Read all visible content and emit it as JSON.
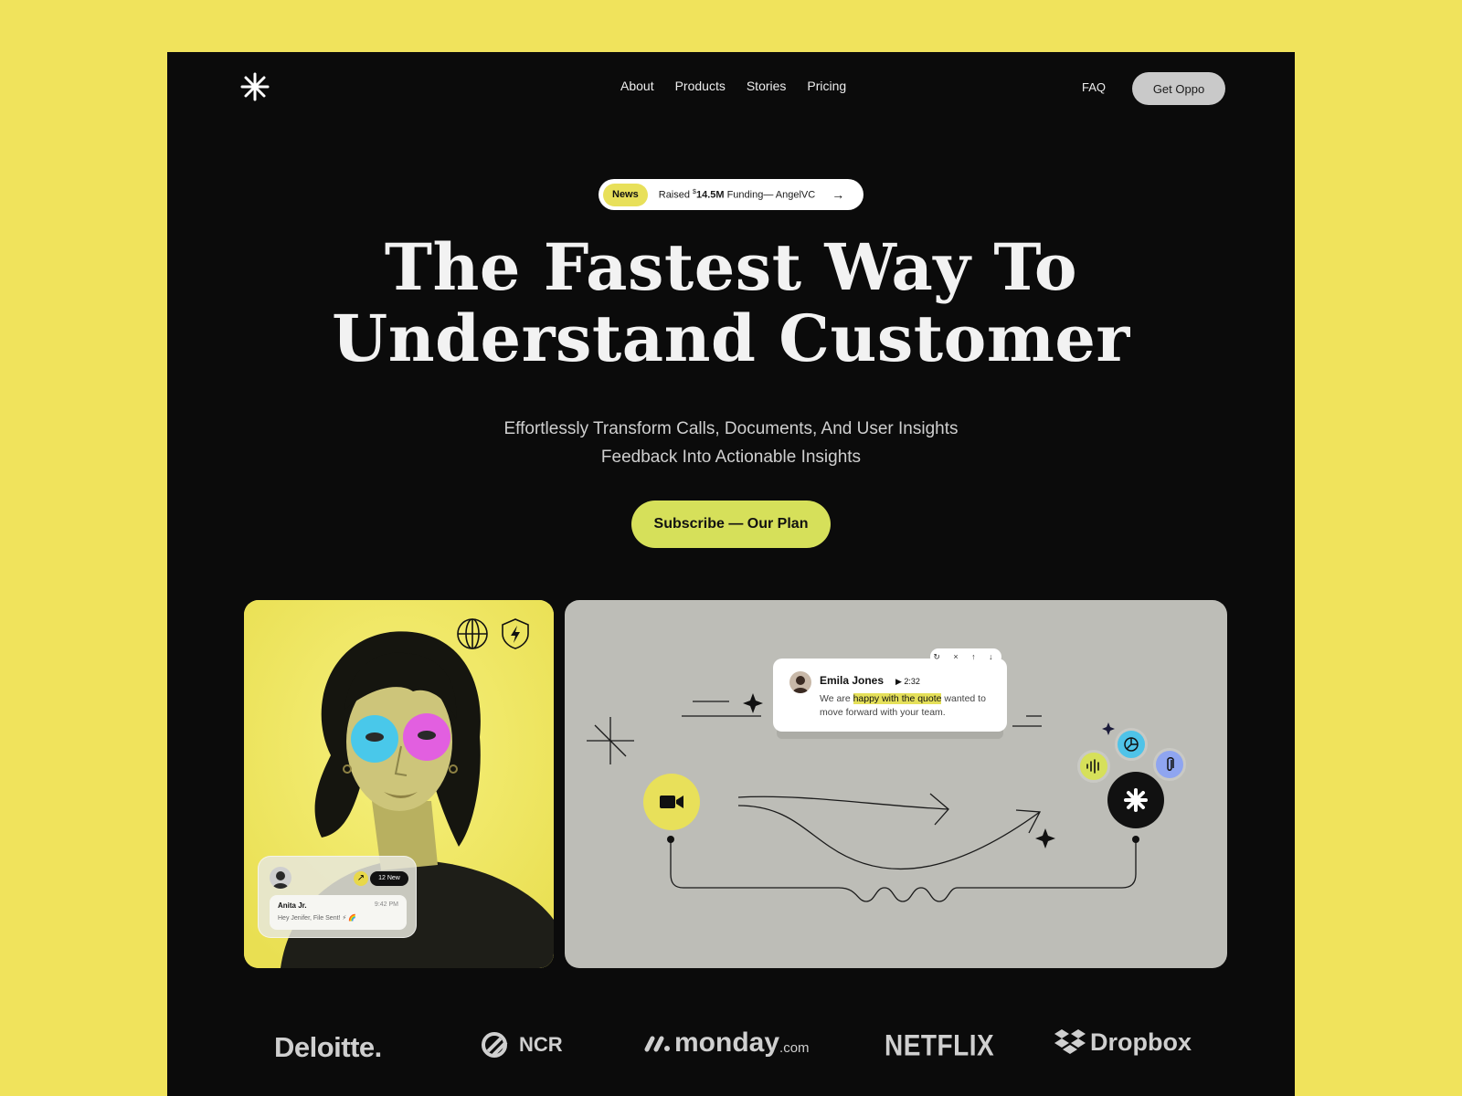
{
  "nav": {
    "links": [
      "About",
      "Products",
      "Stories",
      "Pricing"
    ],
    "faq": "FAQ",
    "cta": "Get Oppo"
  },
  "news": {
    "badge": "News",
    "text_prefix": "Raised ",
    "currency": "$",
    "amount": "14.5M",
    "text_suffix": " Funding— AngelVC",
    "arrow": "→"
  },
  "hero": {
    "title_line1": "The Fastest Way To",
    "title_line2": "Understand Customer",
    "subtitle_line1": "Effortlessly Transform Calls, Documents, And User Insights",
    "subtitle_line2": "Feedback Into Actionable Insights",
    "cta": "Subscribe — Our Plan"
  },
  "notification": {
    "badge": "12 New",
    "name": "Anita Jr.",
    "time": "9:42 PM",
    "message": "Hey Jenifer, File Sent! ⚡ 🌈"
  },
  "quote_bubble": {
    "tools": "↻ × ↑ ↓",
    "name": "Emila Jones",
    "duration": "▶ 2:32",
    "msg_before": "We are ",
    "msg_highlight": "happy with the quote",
    "msg_after": " wanted to move forward with your team."
  },
  "partners": {
    "deloitte": "Deloitte.",
    "ncr": "NCR",
    "monday": "monday",
    "monday_suffix": ".com",
    "netflix": "NETFLIX",
    "dropbox": "Dropbox"
  },
  "colors": {
    "page_bg": "#F0E35C",
    "frame_bg": "#0B0B0B",
    "accent": "#D6E05A",
    "card_grey": "#BDBDB7"
  },
  "icons": [
    "asterisk-logo-icon",
    "globe-icon",
    "shield-bolt-icon",
    "video-camera-icon",
    "audio-wave-icon",
    "pie-chart-icon",
    "paperclip-icon",
    "sparkle-icon"
  ]
}
